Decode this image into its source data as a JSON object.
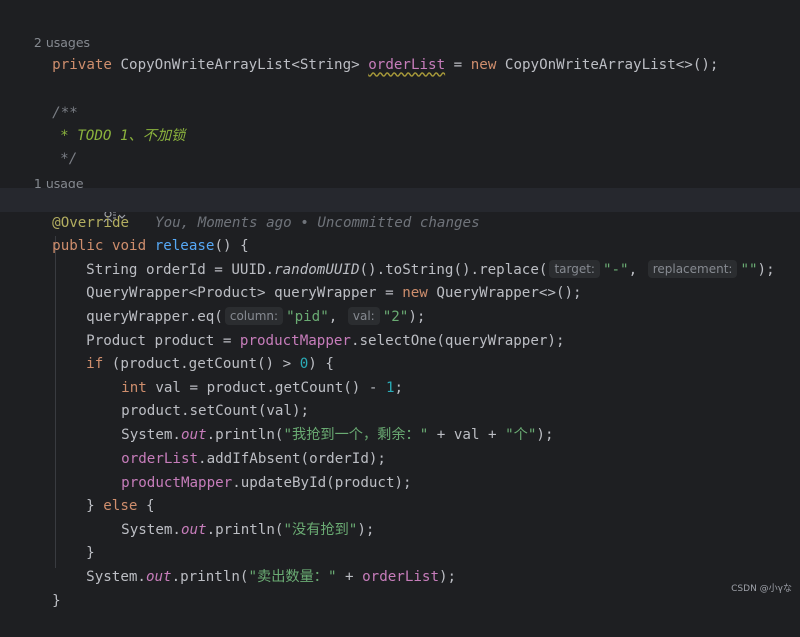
{
  "usages_private": "2 usages",
  "field_decl": {
    "private": "private",
    "type": "CopyOnWriteArrayList<String>",
    "name": "orderList",
    "eq": " = ",
    "new": "new",
    "ctor": "CopyOnWriteArrayList<>();"
  },
  "comment": {
    "open": "/**",
    "todo": "* TODO 1、不加锁",
    "close": "*/"
  },
  "usages_method": "1 usage",
  "gutter_icon": "profile-icon",
  "annotation": "@Override",
  "blame": "You, Moments ago • Uncommitted changes",
  "method_sig": {
    "public": "public",
    "void": "void",
    "name": "release",
    "rest": "() {"
  },
  "lines": {
    "l1_a": "String orderId = UUID.",
    "l1_b": "randomUUID",
    "l1_c": "().toString().replace(",
    "l1_hint1": "target:",
    "l1_str1": "\"-\"",
    "l1_comma": ", ",
    "l1_hint2": "replacement:",
    "l1_str2": "\"\"",
    "l1_end": ");",
    "l2_a": "QueryWrapper<Product> queryWrapper = ",
    "l2_new": "new",
    "l2_b": " QueryWrapper<>();",
    "l3_a": "queryWrapper.eq(",
    "l3_hint1": "column:",
    "l3_str1": "\"pid\"",
    "l3_comma": ", ",
    "l3_hint2": "val:",
    "l3_str2": "\"2\"",
    "l3_end": ");",
    "l4_a": "Product product = ",
    "l4_fld": "productMapper",
    "l4_b": ".selectOne(queryWrapper);",
    "l5_if": "if",
    "l5_a": " (product.getCount() > ",
    "l5_num": "0",
    "l5_b": ") {",
    "l6_int": "int",
    "l6_a": " val = product.getCount() - ",
    "l6_num": "1",
    "l6_b": ";",
    "l7": "product.setCount(val);",
    "l8_a": "System.",
    "l8_out": "out",
    "l8_b": ".println(",
    "l8_str1": "\"我抢到一个，剩余：\"",
    "l8_c": " + val + ",
    "l8_str2": "\"个\"",
    "l8_d": ");",
    "l9_fld": "orderList",
    "l9_b": ".addIfAbsent(orderId);",
    "l10_fld": "productMapper",
    "l10_b": ".updateById(product);",
    "l11_a": "} ",
    "l11_else": "else",
    "l11_b": " {",
    "l12_a": "System.",
    "l12_out": "out",
    "l12_b": ".println(",
    "l12_str": "\"没有抢到\"",
    "l12_c": ");",
    "l13": "}",
    "l14_a": "System.",
    "l14_out": "out",
    "l14_b": ".println(",
    "l14_str": "\"卖出数量：\"",
    "l14_c": " + ",
    "l14_fld": "orderList",
    "l14_d": ");",
    "l15": "}"
  },
  "watermark": "CSDN @小γな"
}
